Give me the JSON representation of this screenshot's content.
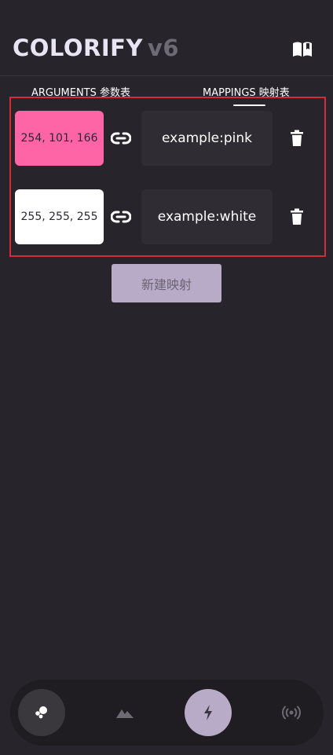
{
  "header": {
    "title": "COLORIFY",
    "version": "v6",
    "docs_icon": "book-open-icon"
  },
  "tabs": [
    {
      "label": "ARGUMENTS 参数表",
      "active": false
    },
    {
      "label": "MAPPINGS 映射表",
      "active": true
    }
  ],
  "mappings": [
    {
      "rgb": "254, 101, 166",
      "color": "#fe65a6",
      "name": "example:pink"
    },
    {
      "rgb": "255, 255, 255",
      "color": "#ffffff",
      "name": "example:white"
    }
  ],
  "new_mapping_label": "新建映射",
  "nav": [
    {
      "icon": "bubbles-icon",
      "active": true
    },
    {
      "icon": "mountain-icon",
      "active": false
    },
    {
      "icon": "lightning-icon",
      "active": true
    },
    {
      "icon": "broadcast-icon",
      "active": false
    }
  ],
  "colors": {
    "background": "#27242b",
    "field": "#2f2c33",
    "accent": "#b8abc8",
    "selection": "#d42a3b"
  }
}
